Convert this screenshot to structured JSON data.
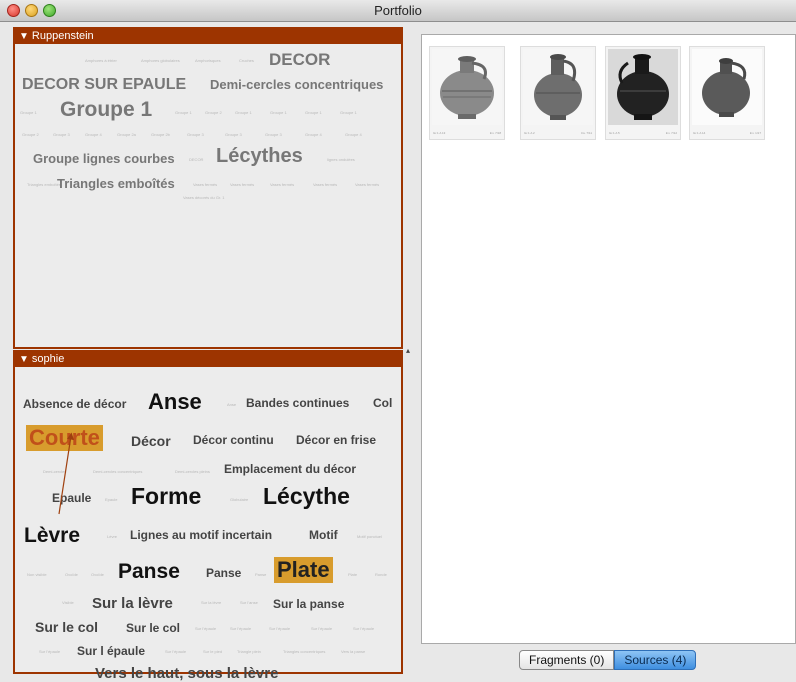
{
  "window": {
    "title": "Portfolio"
  },
  "panel1": {
    "title": "Ruppenstein",
    "tags": [
      "Amphores à étrier",
      "Amphores globulaires",
      "Amphorisques",
      "Cruches",
      "DECOR",
      "DECOR SUR EPAULE",
      "Demi-cercles concentriques",
      "Groupe 1",
      "Groupe 1",
      "Groupe 2",
      "Groupe 1",
      "Groupe 1",
      "Groupe 1",
      "Groupe 1",
      "Groupe 2",
      "Groupe 3",
      "Groupe 4",
      "Groupe 2a",
      "Groupe 2b",
      "Groupe 3",
      "Groupe 3",
      "Groupe 3",
      "Groupe 4",
      "Groupe lignes courbes",
      "Lécythes",
      "lignes ondulées",
      "Triangles emboîtés",
      "Vases fermés",
      "Vases fermés",
      "Vases fermés",
      "Vases fermés",
      "Vases fermés",
      "Vases décorés du Gr. 1"
    ]
  },
  "panel2": {
    "title": "sophie",
    "tags": [
      "Absence de décor",
      "Anse",
      "Anse",
      "Bandes continues",
      "Col",
      "Courte",
      "Décor",
      "Décor continu",
      "Décor en frise",
      "Demi-cercles",
      "Demi-cercles concentriques",
      "Demi-cercles pleins",
      "Emplacement du décor",
      "Epaule",
      "Epaule",
      "Forme",
      "Globulaire",
      "Lécythe",
      "Lèvre",
      "Lèvre",
      "Lignes au motif incertain",
      "Motif",
      "Motif ponctuel",
      "Non visible",
      "Ovoïde",
      "Ovoïde",
      "Panse",
      "Panse",
      "Panse",
      "Plate",
      "Plate",
      "Ronde",
      "Visible",
      "Sur la lèvre",
      "Sur la lèvre",
      "Sur l’anse",
      "Sur la panse",
      "Sur le col",
      "Sur le col",
      "Sur l’épaule",
      "Sur l’épaule",
      "Sur l’épaule",
      "Sur l’épaule",
      "Sur l’épaule",
      "Sur l épaule",
      "Sur l’épaule",
      "Sur le pied",
      "Triangle plein",
      "Triangles concentriques",
      "Vers la panse",
      "Vers le haut, sous la lèvre"
    ]
  },
  "thumbnails": [
    {
      "caption_left": "Gr.1 A 13",
      "caption_right": "Inv. 7/18"
    },
    {
      "caption_left": "Gr.1 A 2",
      "caption_right": "Inv. 7/11"
    },
    {
      "caption_left": "Gr.1 A 5",
      "caption_right": "Inv. 7/12"
    },
    {
      "caption_left": "Gr.1 A 14",
      "caption_right": "Inv. 1/17"
    }
  ],
  "tabs": {
    "fragments": "Fragments (0)",
    "sources": "Sources (4)"
  },
  "colors": {
    "panel_header": "#9d3400",
    "highlight": "#d89c2d",
    "active_tab": "#4d9be6"
  }
}
